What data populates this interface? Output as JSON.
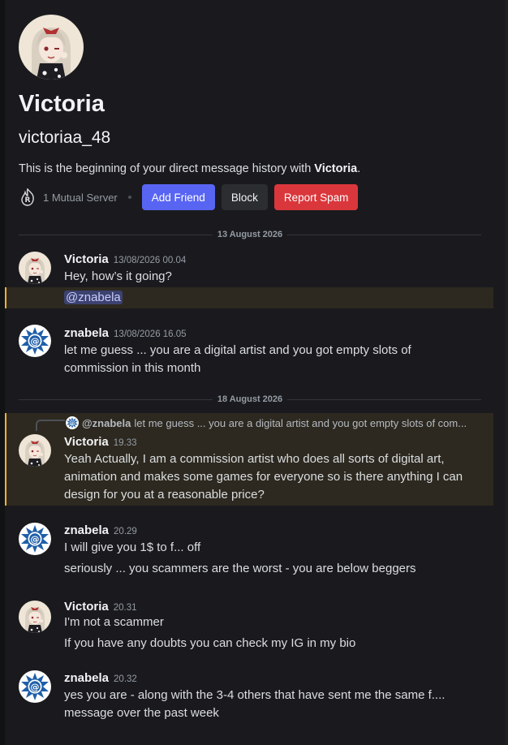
{
  "profile": {
    "display_name": "Victoria",
    "username": "victoriaa_48",
    "intro_prefix": "This is the beginning of your direct message history with ",
    "intro_name": "Victoria",
    "intro_suffix": ".",
    "mutual_servers": "1 Mutual Server",
    "add_friend": "Add Friend",
    "block": "Block",
    "report_spam": "Report Spam"
  },
  "dividers": [
    "13 August 2026",
    "18 August 2026"
  ],
  "messages": [
    {
      "author": "Victoria",
      "time": "13/08/2026 00.04",
      "lines": [
        "Hey, how’s it going?",
        "@znabela"
      ]
    },
    {
      "author": "znabela",
      "time": "13/08/2026 16.05",
      "lines": [
        "let me guess ... you are a digital artist and you got empty slots of",
        "commission in this month"
      ]
    },
    {
      "author": "Victoria",
      "time": "19.33",
      "reply_to": "@znabela",
      "reply_text": "let me guess ... you are a digital artist and you got empty slots of com...",
      "lines": [
        "Yeah Actually, I am a commission artist who does all sorts of digital art,",
        "animation and makes some games for everyone so is there anything I can",
        "design for you at a reasonable price?"
      ]
    },
    {
      "author": "znabela",
      "time": "20.29",
      "lines": [
        "I will give you 1$ to f... off",
        "seriously ... you scammers are the worst - you are below beggers"
      ]
    },
    {
      "author": "Victoria",
      "time": "20.31",
      "lines": [
        "I'm not a scammer",
        "If you have any doubts you can check my IG in my bio"
      ]
    },
    {
      "author": "znabela",
      "time": "20.32",
      "lines": [
        "yes you are - along with the 3-4 others that have sent me the same f....",
        "message over the past week"
      ]
    }
  ],
  "colors": {
    "accent": "#5865f2",
    "danger": "#da373c",
    "mention_highlight": "#f0b232",
    "background": "#1a1a1e"
  },
  "icons": {
    "victoria_avatar": "anime-girl-avatar",
    "znabela_avatar": "blue-sun-at-avatar",
    "server": "flame-r-server-icon"
  }
}
